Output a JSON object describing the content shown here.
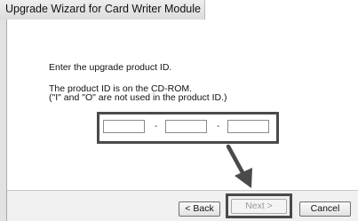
{
  "window": {
    "title": "Upgrade Wizard for Card Writer Module"
  },
  "main": {
    "instruction": "Enter the upgrade product ID.",
    "info_line1": "The product ID is on the CD-ROM.",
    "info_line2": "(\"I\" and \"O\" are not used in the product ID.)",
    "product_id": {
      "segments": [
        {
          "value": "",
          "placeholder": ""
        },
        {
          "value": "",
          "placeholder": ""
        },
        {
          "value": "",
          "placeholder": ""
        }
      ],
      "separator": "-"
    }
  },
  "buttons": {
    "back_label": "< Back",
    "next_label": "Next >",
    "next_enabled": false,
    "cancel_label": "Cancel"
  },
  "icons": {
    "pointer_arrow": "down-right-arrow-icon"
  },
  "colors": {
    "highlight_border": "#4a4a4a",
    "disabled_text": "#9a9a9a"
  }
}
